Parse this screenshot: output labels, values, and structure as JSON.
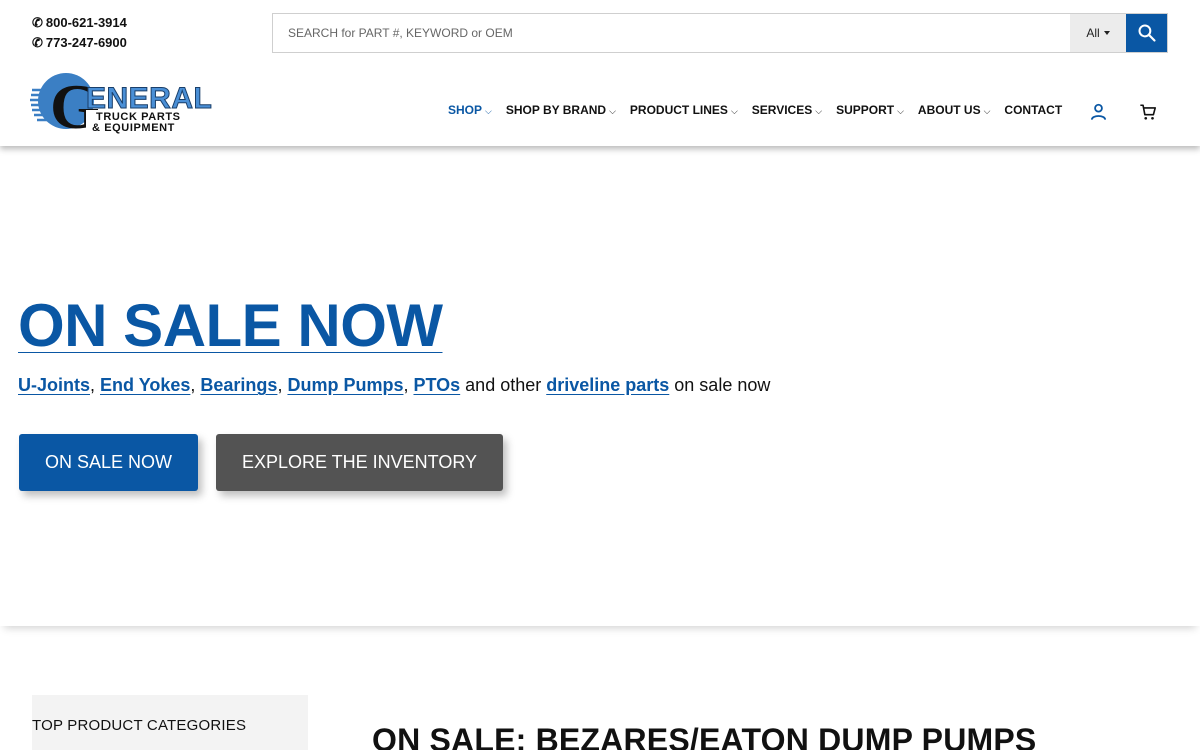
{
  "header": {
    "phones": [
      {
        "icon": "phone-icon",
        "glyph": "✆",
        "number": "800-621-3914"
      },
      {
        "icon": "phone-icon",
        "glyph": "✆",
        "number": "773-247-6900"
      }
    ],
    "search": {
      "placeholder": "SEARCH for PART #, KEYWORD or OEM",
      "value": "",
      "scope": "All",
      "icon": "search-icon"
    },
    "logo": {
      "letter": "G",
      "word": "ENERAL",
      "line1": "TRUCK PARTS",
      "line2": "& EQUIPMENT"
    },
    "nav": [
      {
        "label": "SHOP",
        "chev": "⌵",
        "active": true
      },
      {
        "label": "SHOP BY BRAND",
        "chev": "⌵"
      },
      {
        "label": "PRODUCT LINES",
        "chev": "⌵"
      },
      {
        "label": "SERVICES",
        "chev": "⌵"
      },
      {
        "label": "SUPPORT",
        "chev": "⌵"
      },
      {
        "label": "ABOUT US",
        "chev": "⌵"
      },
      {
        "label": "CONTACT",
        "chev": ""
      }
    ],
    "icons": {
      "account": "user-icon",
      "cart": "cart-icon"
    },
    "colors": {
      "brand": "#0a57a4",
      "secondary": "#535353"
    }
  },
  "hero": {
    "title": "ON SALE NOW",
    "links": [
      "U-Joints",
      "End Yokes",
      "Bearings",
      "Dump Pumps",
      "PTOs"
    ],
    "sep": ", ",
    "middle_text": " and other ",
    "last_link": "driveline parts",
    "tail_text": " on sale now",
    "primary_button": "ON SALE NOW",
    "secondary_button": "EXPLORE THE INVENTORY"
  },
  "lower": {
    "categories_title": "TOP PRODUCT CATEGORIES",
    "sale_heading": "ON SALE: BEZARES/EATON DUMP PUMPS"
  }
}
